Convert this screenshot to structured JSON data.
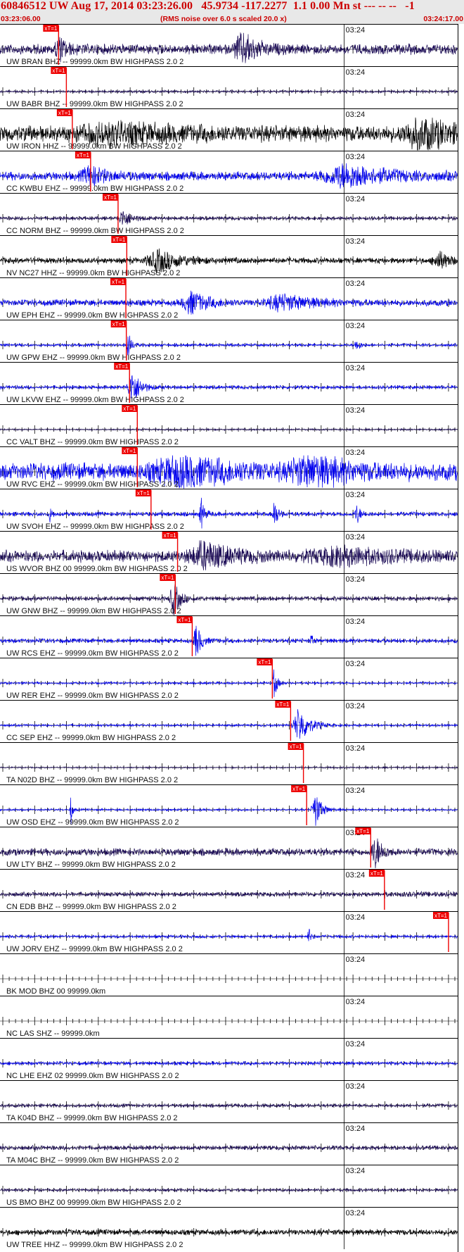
{
  "header": {
    "title": "60846512 UW Aug 17, 2014 03:23:26.00   45.9734 -117.2277  1.1 0.00 Mn st --- -- --   -1",
    "start_time": "03:23:06.00",
    "subtitle": "(RMS noise over 6.0 s scaled 20.0 x)",
    "end_time": "03:24:17.00"
  },
  "minute_label": "03:24",
  "pick_label": "xT=1",
  "colors": {
    "header_bg": "#e8e8e8",
    "header_text": "#cc0000",
    "pick": "#ee0000",
    "trace_black": "#000000",
    "trace_navy": "#1a0a55",
    "trace_blue": "#0000ee",
    "divider": "#000000"
  },
  "traces": [
    {
      "label": "UW BRAN BHZ -- 99999.0km BW  HIGHPASS  2.0  2",
      "color": "navy",
      "amp": 0.35,
      "pick": 0.128,
      "bursts": [
        {
          "at": 0.53,
          "w": 0.025,
          "a": 1.0
        },
        {
          "at": 0.13,
          "w": 0.015,
          "a": 0.6
        }
      ]
    },
    {
      "label": "UW BABR BHZ -- 99999.0km BW  HIGHPASS  2.0  2",
      "color": "navy",
      "amp": 0.07,
      "pick": 0.145,
      "bursts": []
    },
    {
      "label": "UW IRON HHZ -- 99999.0km BW  HIGHPASS  2.0  2",
      "color": "black",
      "amp": 0.55,
      "pick": 0.158,
      "bursts": [
        {
          "at": 0.92,
          "w": 0.05,
          "a": 0.9
        },
        {
          "at": 0.25,
          "w": 0.12,
          "a": 0.4
        }
      ]
    },
    {
      "label": "CC KWBU EHZ -- 99999.0km BW  HIGHPASS  2.0  2",
      "color": "blue",
      "amp": 0.3,
      "pick": 0.198,
      "bursts": [
        {
          "at": 0.76,
          "w": 0.08,
          "a": 0.6
        },
        {
          "at": 0.2,
          "w": 0.03,
          "a": 0.5
        }
      ]
    },
    {
      "label": "CC NORM BHZ -- 99999.0km BW  HIGHPASS  2.0  2",
      "color": "navy",
      "amp": 0.12,
      "pick": 0.258,
      "bursts": [
        {
          "at": 0.27,
          "w": 0.015,
          "a": 0.5
        }
      ]
    },
    {
      "label": "NV NC27 HHZ -- 99999.0km BW  HIGHPASS  2.0  2",
      "color": "black",
      "amp": 0.2,
      "pick": 0.277,
      "bursts": [
        {
          "at": 0.35,
          "w": 0.04,
          "a": 0.6
        },
        {
          "at": 0.96,
          "w": 0.02,
          "a": 0.5
        }
      ]
    },
    {
      "label": "UW EPH EHZ -- 99999.0km BW  HIGHPASS  2.0  2",
      "color": "blue",
      "amp": 0.22,
      "pick": 0.275,
      "bursts": [
        {
          "at": 0.42,
          "w": 0.03,
          "a": 0.6
        },
        {
          "at": 0.62,
          "w": 0.06,
          "a": 0.4
        }
      ]
    },
    {
      "label": "UW GPW EHZ -- 99999.0km BW  HIGHPASS  2.0  2",
      "color": "blue",
      "amp": 0.1,
      "pick": 0.276,
      "bursts": [
        {
          "at": 0.28,
          "w": 0.006,
          "a": 0.8
        },
        {
          "at": 0.78,
          "w": 0.006,
          "a": 0.4
        }
      ]
    },
    {
      "label": "UW LKVW EHZ -- 99999.0km BW  HIGHPASS  2.0  2",
      "color": "blue",
      "amp": 0.12,
      "pick": 0.283,
      "bursts": [
        {
          "at": 0.29,
          "w": 0.015,
          "a": 1.0
        }
      ]
    },
    {
      "label": "CC VALT BHZ -- 99999.0km BW  HIGHPASS  2.0  2",
      "color": "navy",
      "amp": 0.05,
      "pick": 0.3,
      "bursts": []
    },
    {
      "label": "UW RVC EHZ -- 99999.0km BW  HIGHPASS  2.0  2",
      "color": "blue",
      "amp": 0.6,
      "pick": 0.3,
      "bursts": [
        {
          "at": 0.4,
          "w": 0.09,
          "a": 0.7
        },
        {
          "at": 0.68,
          "w": 0.06,
          "a": 0.8
        }
      ]
    },
    {
      "label": "UW SVOH EHZ -- 99999.0km BW  HIGHPASS  2.0  2",
      "color": "blue",
      "amp": 0.15,
      "pick": 0.33,
      "bursts": [
        {
          "at": 0.44,
          "w": 0.006,
          "a": 0.9
        },
        {
          "at": 0.6,
          "w": 0.006,
          "a": 0.8
        },
        {
          "at": 0.11,
          "w": 0.004,
          "a": 0.4
        },
        {
          "at": 0.78,
          "w": 0.006,
          "a": 0.6
        }
      ]
    },
    {
      "label": "US WVOR BHZ 00 99999.0km BW  HIGHPASS  2.0  2",
      "color": "navy",
      "amp": 0.4,
      "pick": 0.388,
      "bursts": [
        {
          "at": 0.45,
          "w": 0.05,
          "a": 0.7
        },
        {
          "at": 0.75,
          "w": 0.1,
          "a": 0.4
        }
      ]
    },
    {
      "label": "UW GNW BHZ -- 99999.0km BW  HIGHPASS  2.0  2",
      "color": "navy",
      "amp": 0.15,
      "pick": 0.383,
      "bursts": [
        {
          "at": 0.38,
          "w": 0.012,
          "a": 1.0
        }
      ]
    },
    {
      "label": "UW RCS EHZ -- 99999.0km BW  HIGHPASS  2.0  2",
      "color": "blue",
      "amp": 0.15,
      "pick": 0.42,
      "bursts": [
        {
          "at": 0.43,
          "w": 0.01,
          "a": 0.9
        },
        {
          "at": 0.68,
          "w": 0.003,
          "a": 0.4
        }
      ]
    },
    {
      "label": "UW RER EHZ -- 99999.0km BW  HIGHPASS  2.0  2",
      "color": "blue",
      "amp": 0.08,
      "pick": 0.595,
      "bursts": [
        {
          "at": 0.6,
          "w": 0.006,
          "a": 0.8
        }
      ]
    },
    {
      "label": "CC SEP EHZ -- 99999.0km BW  HIGHPASS  2.0  2",
      "color": "blue",
      "amp": 0.08,
      "pick": 0.635,
      "bursts": [
        {
          "at": 0.655,
          "w": 0.02,
          "a": 1.0
        }
      ]
    },
    {
      "label": "TA N02D BHZ -- 99999.0km BW  HIGHPASS  2.0  2",
      "color": "navy",
      "amp": 0.05,
      "pick": 0.663,
      "bursts": []
    },
    {
      "label": "UW OSD EHZ -- 99999.0km BW  HIGHPASS  2.0  2",
      "color": "blue",
      "amp": 0.07,
      "pick": 0.67,
      "bursts": [
        {
          "at": 0.69,
          "w": 0.012,
          "a": 1.0
        },
        {
          "at": 0.155,
          "w": 0.003,
          "a": 0.9
        }
      ]
    },
    {
      "label": "UW LTY BHZ -- 99999.0km BW  HIGHPASS  2.0  2",
      "color": "navy",
      "amp": 0.25,
      "pick": 0.81,
      "bursts": [
        {
          "at": 0.82,
          "w": 0.012,
          "a": 1.0
        }
      ]
    },
    {
      "label": "CN EDB BHZ -- 99999.0km BW  HIGHPASS  2.0  2",
      "color": "navy",
      "amp": 0.15,
      "pick": 0.84,
      "bursts": []
    },
    {
      "label": "UW JORV EHZ -- 99999.0km BW  HIGHPASS  2.0  2",
      "color": "blue",
      "amp": 0.1,
      "pick": 0.98,
      "bursts": [
        {
          "at": 0.675,
          "w": 0.004,
          "a": 0.5
        }
      ]
    },
    {
      "label": "BK MOD BHZ 00 99999.0km",
      "color": "none",
      "amp": 0,
      "pick": null,
      "bursts": []
    },
    {
      "label": "NC LAS SHZ -- 99999.0km",
      "color": "none",
      "amp": 0,
      "pick": null,
      "bursts": []
    },
    {
      "label": "NC LHE EHZ 02 99999.0km BW  HIGHPASS  2.0  2",
      "color": "blue",
      "amp": 0.12,
      "pick": null,
      "bursts": []
    },
    {
      "label": "TA K04D BHZ -- 99999.0km BW  HIGHPASS  2.0  2",
      "color": "navy",
      "amp": 0.12,
      "pick": null,
      "bursts": []
    },
    {
      "label": "TA M04C BHZ -- 99999.0km BW  HIGHPASS  2.0  2",
      "color": "navy",
      "amp": 0.15,
      "pick": null,
      "bursts": []
    },
    {
      "label": "US BMO BHZ 00 99999.0km BW  HIGHPASS  2.0  2",
      "color": "navy",
      "amp": 0.1,
      "pick": null,
      "bursts": []
    },
    {
      "label": "UW TREE HHZ -- 99999.0km BW  HIGHPASS  2.0  2",
      "color": "black",
      "amp": 0.2,
      "pick": null,
      "bursts": []
    }
  ]
}
